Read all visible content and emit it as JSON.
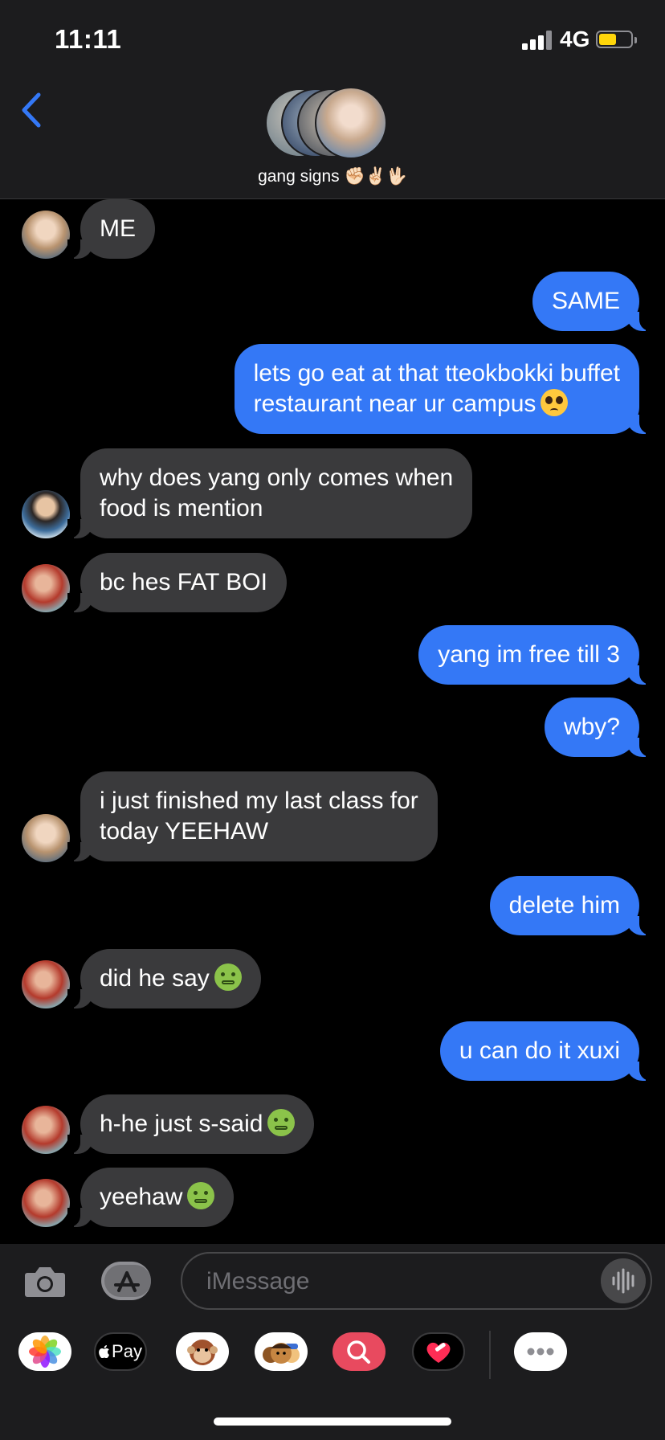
{
  "status": {
    "time": "11:11",
    "network": "4G",
    "battery_level": 0.55
  },
  "header": {
    "group_name": "gang signs ✊🏻✌🏻🖖🏻",
    "back_icon": "chevron-left-icon"
  },
  "messages": [
    {
      "dir": "in",
      "text": "ME",
      "sender": "xuxi"
    },
    {
      "dir": "out",
      "text": "SAME"
    },
    {
      "dir": "out",
      "lines": [
        "lets go eat at that tteokbokki buffet",
        "restaurant near ur campus"
      ],
      "emoji": "pleading-face"
    },
    {
      "dir": "in",
      "lines": [
        "why does yang only comes when",
        "food is mention"
      ],
      "sender": "yang"
    },
    {
      "dir": "in",
      "text": "bc hes FAT BOI",
      "sender": "red"
    },
    {
      "dir": "out",
      "text": "yang im free till 3"
    },
    {
      "dir": "out",
      "text": "wby?"
    },
    {
      "dir": "in",
      "lines": [
        "i just finished my last class for",
        "today YEEHAW"
      ],
      "sender": "xuxi"
    },
    {
      "dir": "out",
      "text": "delete him"
    },
    {
      "dir": "in",
      "text": "did he say",
      "emoji": "nauseated-face",
      "sender": "red"
    },
    {
      "dir": "out",
      "text": "u can do it xuxi"
    },
    {
      "dir": "in",
      "text": "h-he just s-said",
      "emoji": "nauseated-face",
      "sender": "red"
    },
    {
      "dir": "in",
      "text": "yeehaw",
      "emoji": "nauseated-face",
      "sender": "red"
    }
  ],
  "composer": {
    "placeholder": "iMessage",
    "apps": [
      "photos-icon",
      "apple-pay-icon",
      "animoji-icon",
      "memoji-icon",
      "search-images-icon",
      "digital-touch-icon",
      "more-icon"
    ],
    "apple_pay_label": "Pay"
  },
  "colors": {
    "outgoing": "#3478f6",
    "incoming": "#3a3a3c",
    "bar": "#1c1c1e"
  }
}
